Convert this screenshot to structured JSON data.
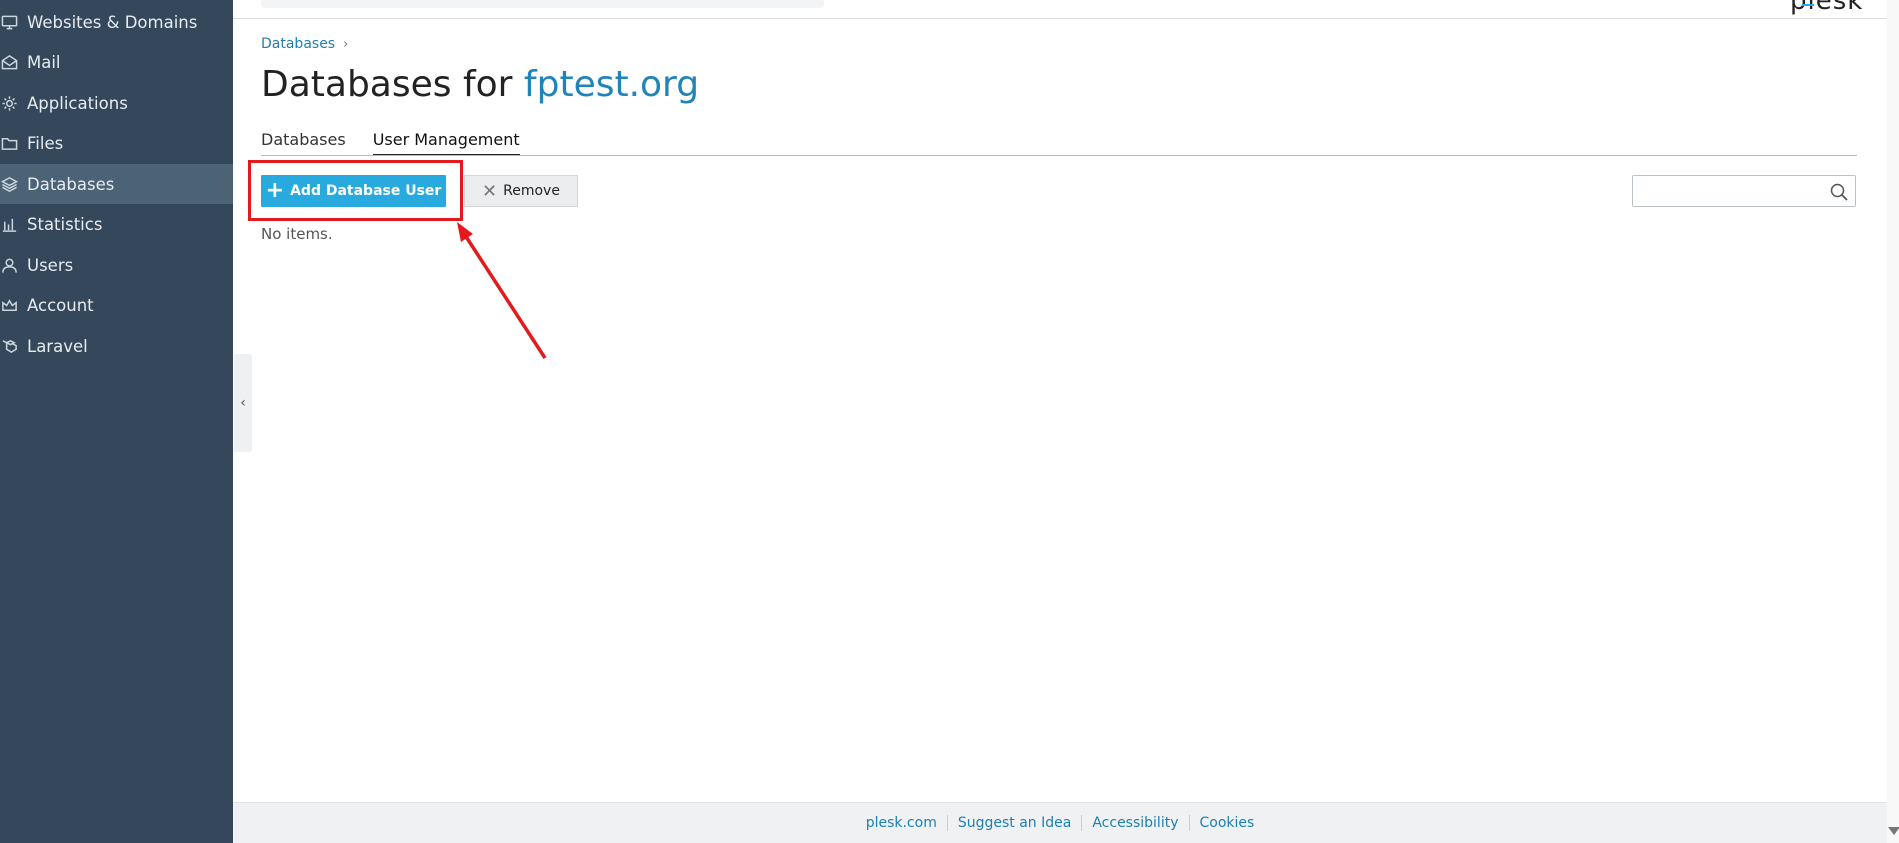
{
  "sidebar": {
    "items": [
      {
        "label": "Websites & Domains",
        "icon": "monitor-icon",
        "active": false
      },
      {
        "label": "Mail",
        "icon": "mail-icon",
        "active": false
      },
      {
        "label": "Applications",
        "icon": "gear-icon",
        "active": false
      },
      {
        "label": "Files",
        "icon": "folder-icon",
        "active": false
      },
      {
        "label": "Databases",
        "icon": "layers-icon",
        "active": true
      },
      {
        "label": "Statistics",
        "icon": "bar-chart-icon",
        "active": false
      },
      {
        "label": "Users",
        "icon": "user-icon",
        "active": false
      },
      {
        "label": "Account",
        "icon": "crown-icon",
        "active": false
      },
      {
        "label": "Laravel",
        "icon": "laravel-icon",
        "active": false
      }
    ]
  },
  "header": {
    "logo": "plesk"
  },
  "breadcrumb": {
    "item": "Databases",
    "separator": "›"
  },
  "page": {
    "title_prefix": "Databases for ",
    "title_domain": "fptest.org"
  },
  "tabs": [
    {
      "label": "Databases",
      "active": false
    },
    {
      "label": "User Management",
      "active": true
    }
  ],
  "toolbar": {
    "add_label": "Add Database User",
    "remove_label": "Remove"
  },
  "search": {
    "value": "",
    "placeholder": ""
  },
  "content": {
    "empty_text": "No items."
  },
  "footer": {
    "links": [
      "plesk.com",
      "Suggest an Idea",
      "Accessibility",
      "Cookies"
    ]
  },
  "colors": {
    "sidebar_bg": "#35475a",
    "sidebar_active": "#4c6275",
    "accent": "#28aade",
    "link": "#1f7fb0",
    "annotation": "#e3191b"
  }
}
